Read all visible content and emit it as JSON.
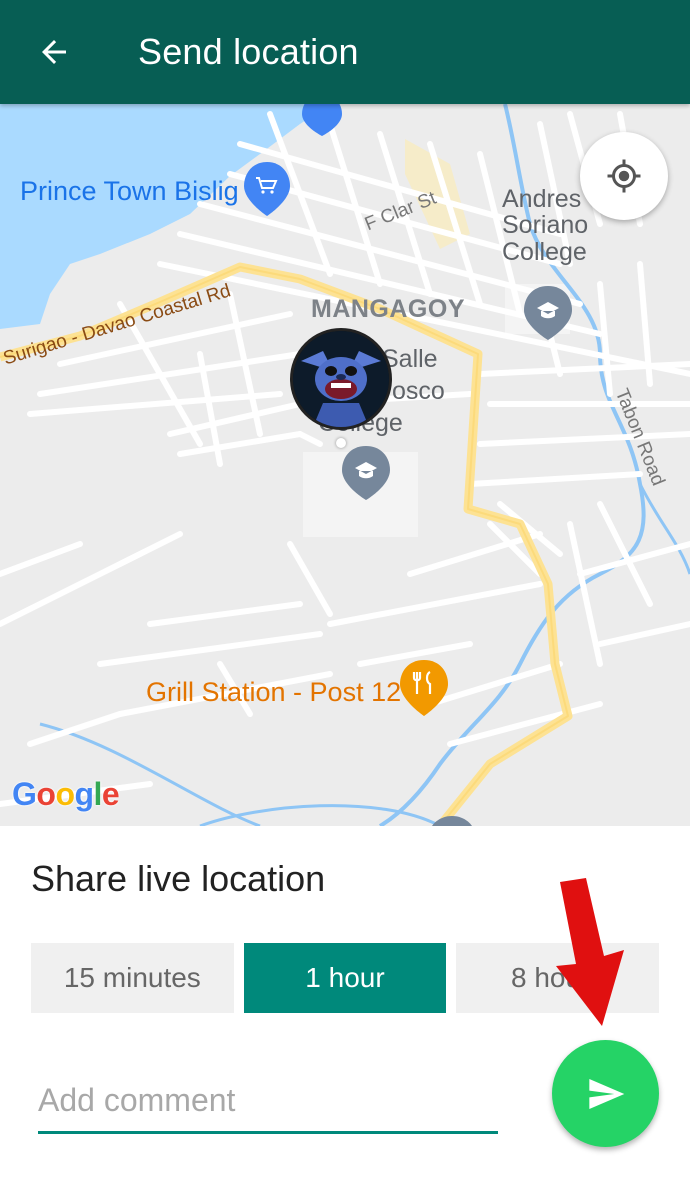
{
  "header": {
    "title": "Send location",
    "back_icon": "arrow-left-icon"
  },
  "map": {
    "labels": {
      "prince_town": "Prince Town Bislig",
      "f_clar": "F Clar St",
      "andres_soriano": "Andres Soriano College",
      "andres_line1": "Andres",
      "andres_line2": "Soriano",
      "andres_line3": "College",
      "mangagoy": "MANGAGOY",
      "coastal_road": "Surigao - Davao Coastal Rd",
      "college_line1": "Salle",
      "college_line2": "osco",
      "college_line3": "College",
      "tabon_road": "Tabon Road",
      "grill_station": "Grill Station - Post 12"
    },
    "attribution": [
      "G",
      "o",
      "o",
      "g",
      "l",
      "e"
    ],
    "locate_icon": "my-location-icon"
  },
  "sheet": {
    "title": "Share live location",
    "durations": [
      {
        "label": "15 minutes",
        "selected": false
      },
      {
        "label": "1 hour",
        "selected": true
      },
      {
        "label": "8 hours",
        "selected": false
      }
    ],
    "comment_placeholder": "Add comment",
    "comment_value": "",
    "send_icon": "send-icon"
  },
  "colors": {
    "toolbar": "#075e54",
    "accent": "#00897b",
    "send": "#25d366",
    "annotation_arrow": "#e01010"
  }
}
